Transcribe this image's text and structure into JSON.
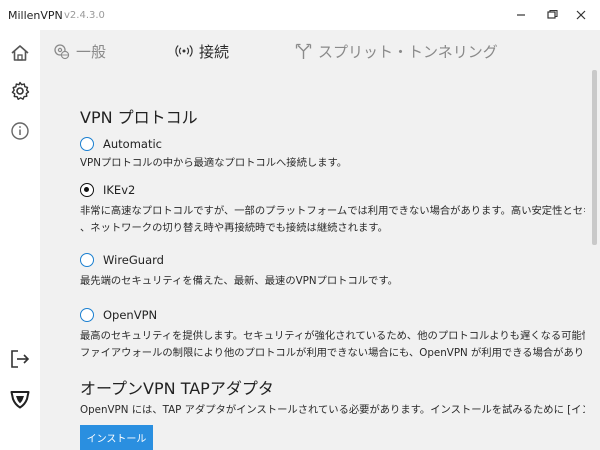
{
  "window": {
    "app_name": "MillenVPN",
    "version": "v2.4.3.0"
  },
  "tabs": [
    {
      "label": "一般",
      "icon": "gear-globe-icon",
      "active": false
    },
    {
      "label": "接続",
      "icon": "wifi-signal-icon",
      "active": true
    },
    {
      "label": "スプリット・トンネリング",
      "icon": "split-arrows-icon",
      "active": false
    }
  ],
  "sidebar": [
    {
      "icon": "home-icon"
    },
    {
      "icon": "gear-icon"
    },
    {
      "icon": "info-icon"
    },
    {
      "icon": "logout-icon"
    },
    {
      "icon": "shield-icon"
    }
  ],
  "protocol_section": {
    "title": "VPN プロトコル",
    "selected": "IKEv2",
    "options": [
      {
        "label": "Automatic",
        "description": [
          "VPNプロトコルの中から最適なプロトコルへ接続します。"
        ]
      },
      {
        "label": "IKEv2",
        "description": [
          "非常に高速なプロトコルですが、一部のプラットフォームでは利用できない場合があります。高い安定性とセキュリティを提供し",
          "、ネットワークの切り替え時や再接続時でも接続は継続されます。"
        ]
      },
      {
        "label": "WireGuard",
        "description": [
          "最先端のセキュリティを備えた、最新、最速のVPNプロトコルです。"
        ]
      },
      {
        "label": "OpenVPN",
        "description": [
          "最高のセキュリティを提供します。セキュリティが強化されているため、他のプロトコルよりも遅くなる可能性があります。また、",
          "ファイアウォールの制限により他のプロトコルが利用できない場合にも、OpenVPN が利用できる場合があります。"
        ]
      }
    ]
  },
  "tap_section": {
    "title": "オープンVPN TAPアダプタ",
    "description": "OpenVPN には、TAP アダプタがインストールされている必要があります。インストールを試みるために [インストール] をクリックし",
    "install_button": "インストール"
  },
  "colors": {
    "accent": "#2a8fe0",
    "radio_border": "#1a7fd0",
    "content_bg": "#f1f1f1"
  }
}
